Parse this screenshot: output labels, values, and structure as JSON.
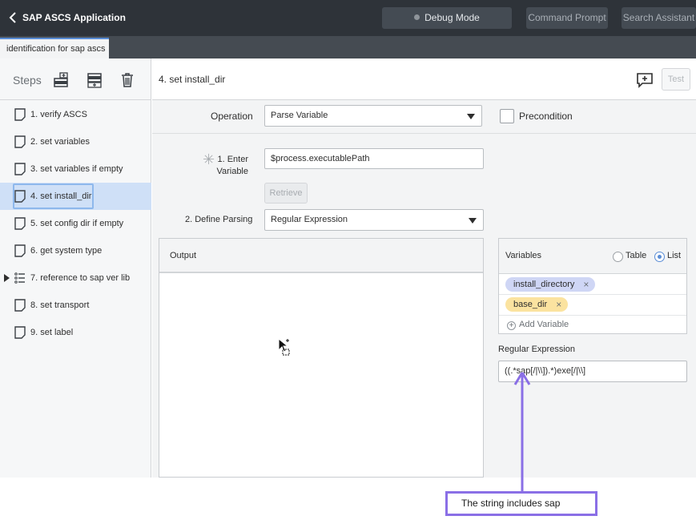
{
  "header": {
    "back_icon": "chevron-left-icon",
    "app_title": "SAP ASCS Application",
    "debug_label": "Debug Mode",
    "command_label": "Command Prompt",
    "search_label": "Search Assistant"
  },
  "tab": {
    "label": "identification for sap ascs"
  },
  "sidebar": {
    "title": "Steps",
    "toolbar_icons": [
      "insert-step-above-icon",
      "insert-step-below-icon",
      "trash-icon"
    ],
    "items": [
      {
        "label": "1. verify ASCS",
        "icon": "page-icon"
      },
      {
        "label": "2. set variables",
        "icon": "page-icon"
      },
      {
        "label": "3. set variables if empty",
        "icon": "page-icon"
      },
      {
        "label": "4. set install_dir",
        "icon": "page-icon",
        "selected": true
      },
      {
        "label": "5. set config dir if empty",
        "icon": "page-icon"
      },
      {
        "label": "6. get system type",
        "icon": "page-icon"
      },
      {
        "label": "7. reference to sap ver lib",
        "icon": "list-icon",
        "expandable": true
      },
      {
        "label": "8. set transport",
        "icon": "page-icon"
      },
      {
        "label": "9. set label",
        "icon": "page-icon"
      }
    ]
  },
  "main": {
    "title": "4. set install_dir",
    "comment_icon": "add-comment-icon",
    "test_label": "Test",
    "operation_label": "Operation",
    "operation_value": "Parse Variable",
    "precondition_label": "Precondition",
    "enter_variable_label_1": "1. Enter",
    "enter_variable_label_2": "Variable",
    "variable_value": "$process.executablePath",
    "retrieve_label": "Retrieve",
    "define_parsing_label": "2. Define Parsing",
    "define_parsing_value": "Regular Expression",
    "output_label": "Output"
  },
  "variables": {
    "title": "Variables",
    "view_options": [
      "Table",
      "List"
    ],
    "selected_view": "List",
    "items": [
      "install_directory",
      "base_dir"
    ],
    "item_colors": [
      "#cfd6f5",
      "#fbe3a0"
    ],
    "add_label": "Add Variable"
  },
  "regex": {
    "label": "Regular Expression",
    "value": "((.*sap[/|\\\\]).*)exe[/|\\\\]"
  },
  "annotation": {
    "text": "The string includes sap",
    "color": "#8a6fe6"
  }
}
